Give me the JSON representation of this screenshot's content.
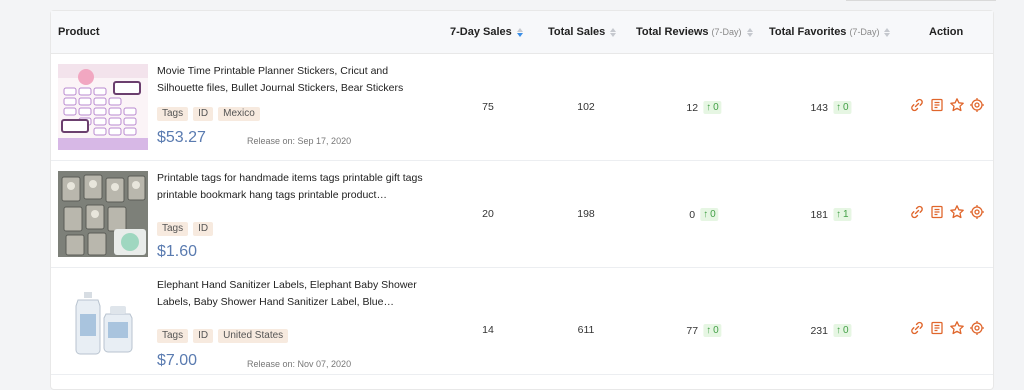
{
  "columns": {
    "product": "Product",
    "seven_day_sales": "7-Day Sales",
    "total_sales": "Total Sales",
    "total_reviews": "Total Reviews",
    "total_reviews_sub": "(7-Day)",
    "total_favorites": "Total Favorites",
    "total_favorites_sub": "(7-Day)",
    "action": "Action"
  },
  "rows": [
    {
      "title": "Movie Time Printable Planner Stickers, Cricut and Silhouette files, Bullet Journal Stickers, Bear Stickers",
      "tags": [
        "Tags",
        "ID",
        "Mexico"
      ],
      "price": "$53.27",
      "release": "Release on: Sep 17, 2020",
      "seven_day_sales": "75",
      "total_sales": "102",
      "reviews": "12",
      "reviews_delta": "0",
      "favorites": "143",
      "favorites_delta": "0"
    },
    {
      "title": "Printable tags for handmade items tags printable gift tags printable bookmark hang tags printable product…",
      "tags": [
        "Tags",
        "ID"
      ],
      "price": "$1.60",
      "release": "",
      "seven_day_sales": "20",
      "total_sales": "198",
      "reviews": "0",
      "reviews_delta": "0",
      "favorites": "181",
      "favorites_delta": "1"
    },
    {
      "title": "Elephant Hand Sanitizer Labels, Elephant Baby Shower Labels, Baby Shower Hand Sanitizer Label, Blue…",
      "tags": [
        "Tags",
        "ID",
        "United States"
      ],
      "price": "$7.00",
      "release": "Release on: Nov 07, 2020",
      "seven_day_sales": "14",
      "total_sales": "611",
      "reviews": "77",
      "reviews_delta": "0",
      "favorites": "231",
      "favorites_delta": "0"
    }
  ],
  "action_icons": [
    "link-icon",
    "report-icon",
    "star-icon",
    "settings-icon"
  ],
  "colors": {
    "price": "#5a7bb0",
    "action_icon": "#e0662c",
    "delta_bg": "#e6f6e3",
    "delta_text": "#43a047",
    "tag_bg": "#f7eadf",
    "sort_active": "#3a8ee6"
  }
}
